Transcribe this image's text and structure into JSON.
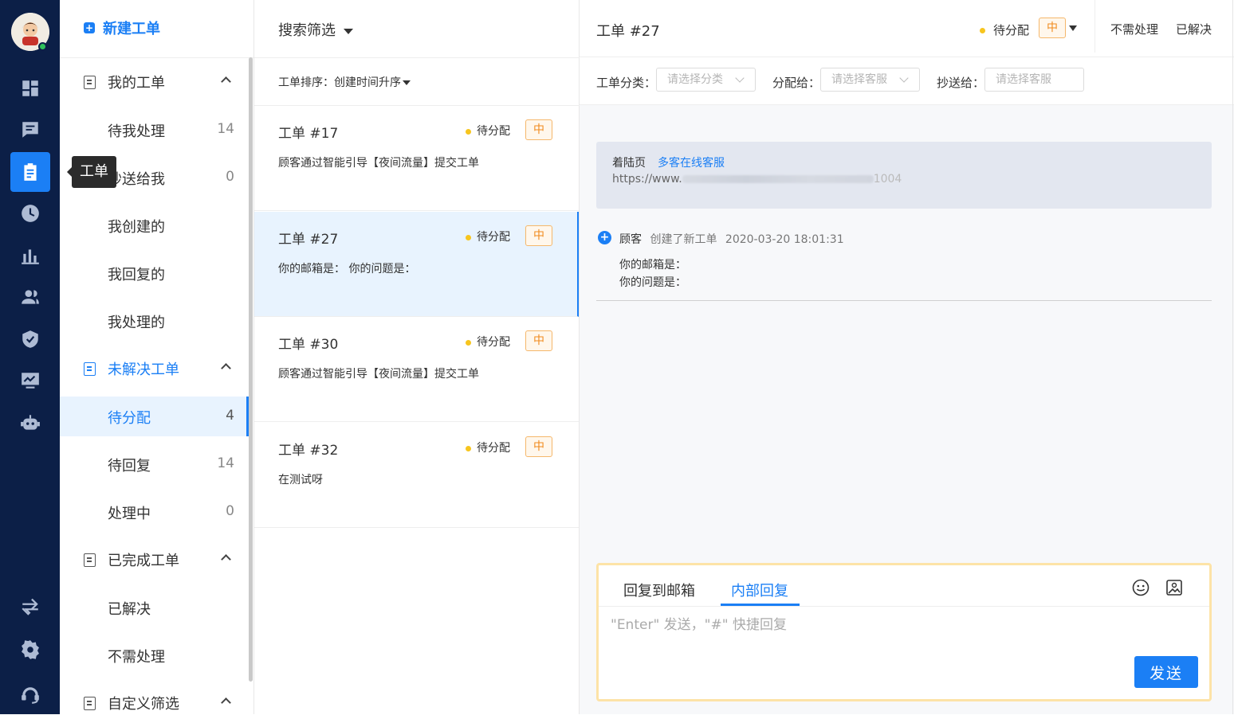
{
  "rail": {
    "icons": [
      "dashboard-icon",
      "chat-icon",
      "ticket-icon",
      "history-icon",
      "report-icon",
      "customers-icon",
      "security-icon",
      "monitor-icon",
      "robot-icon",
      "switch-icon",
      "settings-icon",
      "support-icon"
    ],
    "active": "ticket-icon",
    "tooltip": "工单",
    "accent": "#1b7ff5",
    "background": "#0c1f47"
  },
  "nav": {
    "new_ticket": "新建工单",
    "my_tickets": {
      "label": "我的工单",
      "items": [
        {
          "label": "待我处理",
          "count": "14"
        },
        {
          "label": "抄送给我",
          "count": "0"
        },
        {
          "label": "我创建的",
          "count": ""
        },
        {
          "label": "我回复的",
          "count": ""
        },
        {
          "label": "我处理的",
          "count": ""
        }
      ]
    },
    "unresolved": {
      "label": "未解决工单",
      "items": [
        {
          "label": "待分配",
          "count": "4"
        },
        {
          "label": "待回复",
          "count": "14"
        },
        {
          "label": "处理中",
          "count": "0"
        }
      ]
    },
    "completed": {
      "label": "已完成工单",
      "items": [
        {
          "label": "已解决"
        },
        {
          "label": "不需处理"
        }
      ]
    },
    "custom": {
      "label": "自定义筛选"
    }
  },
  "list": {
    "filter_label": "搜索筛选",
    "sort_label": "工单排序：",
    "sort_value": "创建时间升序",
    "cards": [
      {
        "title": "工单 #17",
        "status": "待分配",
        "priority": "中",
        "desc": "顾客通过智能引导【夜间流量】提交工单"
      },
      {
        "title": "工单 #27",
        "status": "待分配",
        "priority": "中",
        "desc": "你的邮箱是：  你的问题是："
      },
      {
        "title": "工单 #30",
        "status": "待分配",
        "priority": "中",
        "desc": "顾客通过智能引导【夜间流量】提交工单"
      },
      {
        "title": "工单 #32",
        "status": "待分配",
        "priority": "中",
        "desc": "在测试呀"
      }
    ]
  },
  "detail": {
    "title": "工单 #27",
    "status": "待分配",
    "priority": "中",
    "actions": {
      "no_need": "不需处理",
      "resolved": "已解决"
    },
    "fields": {
      "category_label": "工单分类：",
      "category_placeholder": "请选择分类",
      "assign_label": "分配给：",
      "assign_placeholder": "请选择客服",
      "cc_label": "抄送给：",
      "cc_placeholder": "请选择客服"
    },
    "landing": {
      "title": "着陆页",
      "link": "多客在线客服",
      "url_prefix": "https://www.",
      "url_suffix": "1004"
    },
    "event": {
      "actor": "顾客",
      "action": "创建了新工单",
      "time": "2020-03-20 18:01:31",
      "lines": [
        "你的邮箱是：",
        "你的问题是："
      ]
    },
    "composer": {
      "tab_email": "回复到邮箱",
      "tab_internal": "内部回复",
      "placeholder": "\"Enter\" 发送，\"#\" 快捷回复",
      "send": "发送"
    }
  }
}
